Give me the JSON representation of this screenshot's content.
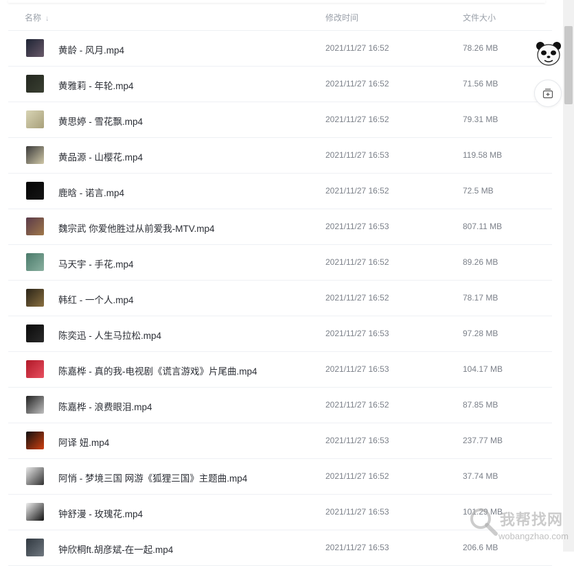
{
  "header": {
    "name_label": "名称",
    "time_label": "修改时间",
    "size_label": "文件大小"
  },
  "files": [
    {
      "name": "黄龄 - 风月.mp4",
      "time": "2021/11/27 16:52",
      "size": "78.26 MB",
      "c1": "#1e2434",
      "c2": "#6a5a6a"
    },
    {
      "name": "黄雅莉 - 年轮.mp4",
      "time": "2021/11/27 16:52",
      "size": "71.56 MB",
      "c1": "#23271f",
      "c2": "#3a3f32"
    },
    {
      "name": "黄思婷 - 雪花飘.mp4",
      "time": "2021/11/27 16:52",
      "size": "79.31 MB",
      "c1": "#d8d4b4",
      "c2": "#a8a07a"
    },
    {
      "name": "黄品源 - 山樱花.mp4",
      "time": "2021/11/27 16:53",
      "size": "119.58 MB",
      "c1": "#3a3a3a",
      "c2": "#d0c8a8"
    },
    {
      "name": "鹿晗 - 诺言.mp4",
      "time": "2021/11/27 16:52",
      "size": "72.5 MB",
      "c1": "#050505",
      "c2": "#151515"
    },
    {
      "name": "魏宗武 你爱他胜过从前爱我-MTV.mp4",
      "time": "2021/11/27 16:53",
      "size": "807.11 MB",
      "c1": "#5a3a4a",
      "c2": "#a0784a"
    },
    {
      "name": "马天宇 - 手花.mp4",
      "time": "2021/11/27 16:52",
      "size": "89.26 MB",
      "c1": "#4a7a6a",
      "c2": "#8ab0a0"
    },
    {
      "name": "韩红 - 一个人.mp4",
      "time": "2021/11/27 16:52",
      "size": "78.17 MB",
      "c1": "#2a2418",
      "c2": "#8a7040"
    },
    {
      "name": "陈奕迅 - 人生马拉松.mp4",
      "time": "2021/11/27 16:53",
      "size": "97.28 MB",
      "c1": "#0a0a0a",
      "c2": "#2a2a2a"
    },
    {
      "name": "陈嘉桦 - 真的我-电视剧《谎言游戏》片尾曲.mp4",
      "time": "2021/11/27 16:53",
      "size": "104.17 MB",
      "c1": "#b01828",
      "c2": "#e85060"
    },
    {
      "name": "陈嘉桦 - 浪费眼泪.mp4",
      "time": "2021/11/27 16:52",
      "size": "87.85 MB",
      "c1": "#202020",
      "c2": "#c0c0c0"
    },
    {
      "name": "阿译 妞.mp4",
      "time": "2021/11/27 16:53",
      "size": "237.77 MB",
      "c1": "#101010",
      "c2": "#d04010"
    },
    {
      "name": "阿悄 - 梦境三国 网游《狐狸三国》主题曲.mp4",
      "time": "2021/11/27 16:52",
      "size": "37.74 MB",
      "c1": "#e8e8e8",
      "c2": "#303030"
    },
    {
      "name": "钟舒漫 - 玫瑰花.mp4",
      "time": "2021/11/27 16:53",
      "size": "101.29 MB",
      "c1": "#f0f0f0",
      "c2": "#101010"
    },
    {
      "name": "钟欣桐ft.胡彦斌-在一起.mp4",
      "time": "2021/11/27 16:53",
      "size": "206.6 MB",
      "c1": "#303840",
      "c2": "#707880"
    }
  ],
  "watermark": {
    "text": "我帮找网",
    "url": "wobangzhao.com"
  },
  "icons": {
    "sort": "sort-arrow-icon",
    "panda": "panda-avatar-icon",
    "add": "add-to-list-icon"
  }
}
